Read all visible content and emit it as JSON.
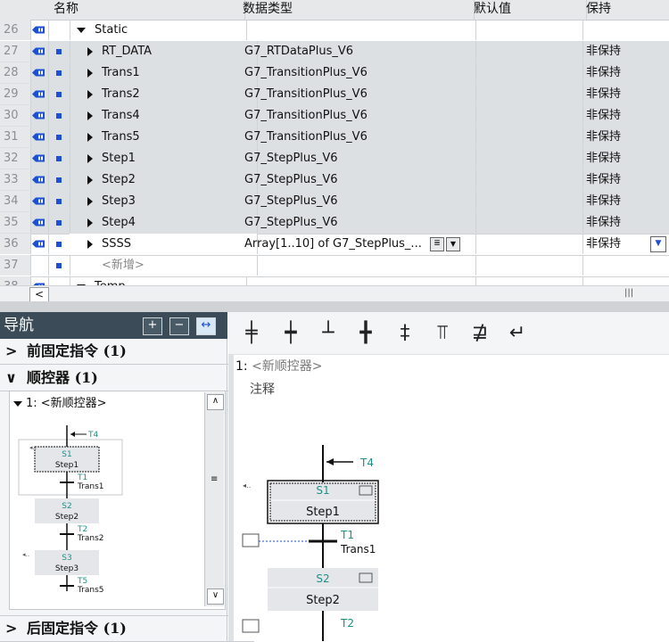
{
  "table": {
    "headers": [
      "名称",
      "数据类型",
      "默认值",
      "保持"
    ],
    "rows": [
      {
        "num": "26",
        "port": true,
        "bullet": false,
        "arrow": "down",
        "name": "Static",
        "type": "",
        "keep": "",
        "grey": false,
        "sel": false,
        "indent": 0
      },
      {
        "num": "27",
        "port": true,
        "bullet": true,
        "arrow": "right",
        "name": "RT_DATA",
        "type": "G7_RTDataPlus_V6",
        "keep": "非保持",
        "grey": true,
        "sel": false,
        "indent": 1
      },
      {
        "num": "28",
        "port": true,
        "bullet": true,
        "arrow": "right",
        "name": "Trans1",
        "type": "G7_TransitionPlus_V6",
        "keep": "非保持",
        "grey": true,
        "sel": false,
        "indent": 1
      },
      {
        "num": "29",
        "port": true,
        "bullet": true,
        "arrow": "right",
        "name": "Trans2",
        "type": "G7_TransitionPlus_V6",
        "keep": "非保持",
        "grey": true,
        "sel": false,
        "indent": 1
      },
      {
        "num": "30",
        "port": true,
        "bullet": true,
        "arrow": "right",
        "name": "Trans4",
        "type": "G7_TransitionPlus_V6",
        "keep": "非保持",
        "grey": true,
        "sel": false,
        "indent": 1
      },
      {
        "num": "31",
        "port": true,
        "bullet": true,
        "arrow": "right",
        "name": "Trans5",
        "type": "G7_TransitionPlus_V6",
        "keep": "非保持",
        "grey": true,
        "sel": false,
        "indent": 1
      },
      {
        "num": "32",
        "port": true,
        "bullet": true,
        "arrow": "right",
        "name": "Step1",
        "type": "G7_StepPlus_V6",
        "keep": "非保持",
        "grey": true,
        "sel": false,
        "indent": 1
      },
      {
        "num": "33",
        "port": true,
        "bullet": true,
        "arrow": "right",
        "name": "Step2",
        "type": "G7_StepPlus_V6",
        "keep": "非保持",
        "grey": true,
        "sel": false,
        "indent": 1
      },
      {
        "num": "34",
        "port": true,
        "bullet": true,
        "arrow": "right",
        "name": "Step3",
        "type": "G7_StepPlus_V6",
        "keep": "非保持",
        "grey": true,
        "sel": false,
        "indent": 1
      },
      {
        "num": "35",
        "port": true,
        "bullet": true,
        "arrow": "right",
        "name": "Step4",
        "type": "G7_StepPlus_V6",
        "keep": "非保持",
        "grey": true,
        "sel": false,
        "indent": 1
      },
      {
        "num": "36",
        "port": true,
        "bullet": true,
        "arrow": "right",
        "name": "SSSS",
        "type": "Array[1..10] of G7_StepPlus_...",
        "keep": "非保持",
        "grey": false,
        "sel": true,
        "indent": 1
      },
      {
        "num": "37",
        "port": false,
        "bullet": true,
        "arrow": "",
        "name": "<新增>",
        "type": "",
        "keep": "",
        "grey": false,
        "sel": false,
        "indent": 1
      },
      {
        "num": "38",
        "port": true,
        "bullet": false,
        "arrow": "down",
        "name": "Temp",
        "type": "",
        "keep": "",
        "grey": false,
        "sel": false,
        "indent": 0
      }
    ]
  },
  "nav": {
    "title": "导航",
    "sections": [
      {
        "label": "前固定指令 (1)",
        "expanded": false
      },
      {
        "label": "顺控器 (1)",
        "expanded": true
      },
      {
        "label": "后固定指令 (1)",
        "expanded": false
      }
    ],
    "sequencer_label": "1: <新顺控器>",
    "mini": {
      "t_top": "T4",
      "steps": [
        {
          "num": "S1",
          "name": "Step1",
          "trans": "T1",
          "trans_name": "Trans1"
        },
        {
          "num": "S2",
          "name": "Step2",
          "trans": "T2",
          "trans_name": "Trans2"
        },
        {
          "num": "S3",
          "name": "Step3",
          "trans": "T5",
          "trans_name": "Trans5"
        }
      ]
    }
  },
  "editor": {
    "toolbar_icons": [
      "step-transition-icon",
      "step-icon",
      "transition-icon",
      "jump-icon",
      "branch-icon",
      "sim-branch-icon",
      "close-branch-icon",
      "return-icon"
    ],
    "seq_number": "1:",
    "seq_name": "<新顺控器>",
    "comment": "注释",
    "graph": {
      "t_top": "T4",
      "step1_num": "S1",
      "step1_name": "Step1",
      "trans1": "T1",
      "trans1_name": "Trans1",
      "step2_num": "S2",
      "step2_name": "Step2",
      "trans2": "T2"
    }
  },
  "colors": {
    "accent": "#1a4fd6",
    "teal": "#1f8f86",
    "nav_title": "#3b4b57"
  }
}
